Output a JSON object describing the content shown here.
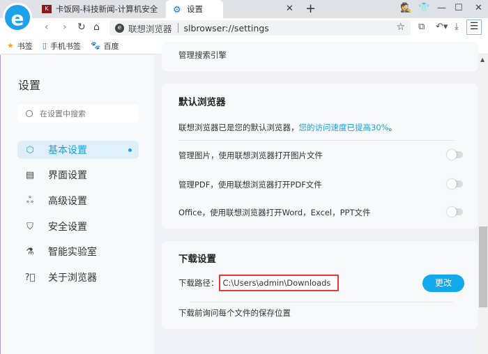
{
  "browser": {
    "tabs": [
      {
        "label": "卡饭网-科技新闻-计算机安全",
        "favicon": "kafan-icon"
      },
      {
        "label": "设置",
        "favicon": "gear-icon",
        "active": true
      }
    ],
    "site_name": "联想浏览器",
    "url": "slbrowser://settings",
    "bookmarks": [
      {
        "label": "书签",
        "icon": "star-icon"
      },
      {
        "label": "手机书签",
        "icon": "phone-icon"
      },
      {
        "label": "百度",
        "icon": "baidu-paw-icon"
      }
    ]
  },
  "sidebar": {
    "title": "设置",
    "search_placeholder": "在设置中搜索",
    "items": [
      {
        "label": "基本设置",
        "icon": "hexagon-gear-icon",
        "active": true
      },
      {
        "label": "界面设置",
        "icon": "window-icon"
      },
      {
        "label": "高级设置",
        "icon": "circles-icon"
      },
      {
        "label": "安全设置",
        "icon": "shield-icon"
      },
      {
        "label": "智能实验室",
        "icon": "flask-icon"
      },
      {
        "label": "关于浏览器",
        "icon": "help-icon"
      }
    ]
  },
  "main": {
    "partial_card_label": "管理搜索引擎",
    "default_browser": {
      "title": "默认浏览器",
      "status": "联想浏览器已是您的默认浏览器，",
      "status_link": "您的访问速度已提高30%",
      "status_end": "。",
      "options": [
        {
          "label": "管理图片，使用联想浏览器打开图片文件",
          "enabled": false
        },
        {
          "label": "管理PDF，使用联想浏览器打开PDF文件",
          "enabled": false
        },
        {
          "label": "Office，使用联想浏览器打开Word，Excel，PPT文件",
          "enabled": false
        }
      ]
    },
    "download": {
      "title": "下载设置",
      "path_label": "下载路径：",
      "path_value": "C:\\Users\\admin\\Downloads",
      "change_button": "更改",
      "ask_label": "下载前询问每个文件的保存位置"
    }
  },
  "colors": {
    "accent": "#12a8ec",
    "highlight_box": "#e53935"
  }
}
